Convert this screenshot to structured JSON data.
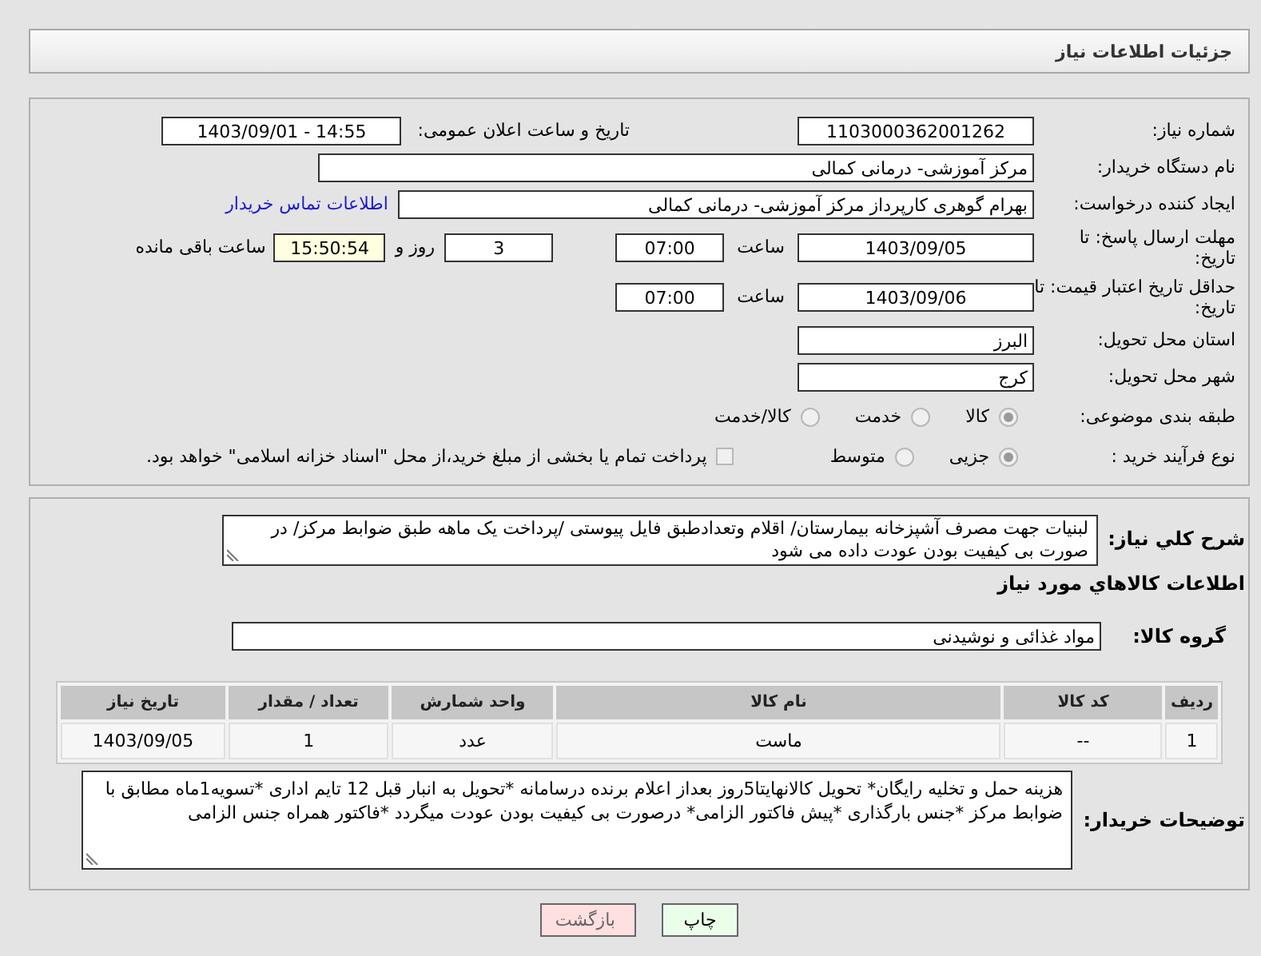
{
  "page_title": "جزئیات اطلاعات نیاز",
  "details": {
    "need_number": {
      "label": "شماره نیاز:",
      "value": "1103000362001262"
    },
    "announce_datetime": {
      "label": "تاریخ و ساعت اعلان عمومی:",
      "value": "1403/09/01 - 14:55"
    },
    "buyer_org": {
      "label": "نام دستگاه خریدار:",
      "value": "مرکز آموزشی- درمانی کمالی"
    },
    "requester": {
      "label": "ایجاد کننده درخواست:",
      "value": "بهرام گوهری کارپرداز مرکز آموزشی- درمانی کمالی",
      "link": "اطلاعات تماس خریدار"
    },
    "reply_deadline": {
      "label": "مهلت ارسال پاسخ: تا تاریخ:",
      "date": "1403/09/05",
      "time_label": "ساعت",
      "time": "07:00",
      "days": "3",
      "days_label": "روز و",
      "remaining": "15:50:54",
      "remaining_label": "ساعت باقی مانده"
    },
    "price_validity": {
      "label": "حداقل تاریخ اعتبار قیمت: تا تاریخ:",
      "date": "1403/09/06",
      "time_label": "ساعت",
      "time": "07:00"
    },
    "province": {
      "label": "استان محل تحویل:",
      "value": "البرز"
    },
    "city": {
      "label": "شهر محل تحویل:",
      "value": "کرج"
    },
    "category": {
      "label": "طبقه بندی موضوعی:",
      "options": [
        {
          "label": "کالا",
          "selected": true
        },
        {
          "label": "خدمت",
          "selected": false
        },
        {
          "label": "کالا/خدمت",
          "selected": false
        }
      ]
    },
    "process": {
      "label": "نوع فرآیند خرید :",
      "options": [
        {
          "label": "جزیی",
          "selected": true
        },
        {
          "label": "متوسط",
          "selected": false
        }
      ],
      "treasury": {
        "label": "پرداخت تمام یا بخشی از مبلغ خرید،از محل \"اسناد خزانه اسلامی\" خواهد بود.",
        "checked": false
      }
    }
  },
  "items": {
    "description": {
      "label": "شرح کلي نياز:",
      "value": "لبنیات جهت مصرف آشپزخانه بیمارستان/ اقلام وتعدادطبق فایل پیوستی /پرداخت یک ماهه طبق ضوابط مرکز/ در صورت بی کیفیت بودن عودت داده می شود"
    },
    "heading": "اطلاعات کالاهاي مورد نياز",
    "group": {
      "label": "گروه کالا:",
      "value": "مواد غذائی و نوشیدنی"
    },
    "table": {
      "columns": [
        "ردیف",
        "کد کالا",
        "نام کالا",
        "واحد شمارش",
        "تعداد / مقدار",
        "تاریخ نیاز"
      ],
      "rows": [
        [
          "1",
          "--",
          "ماست",
          "عدد",
          "1",
          "1403/09/05"
        ]
      ]
    },
    "buyer_notes": {
      "label": "توضیحات خریدار:",
      "value": "هزینه حمل و تخلیه رایگان* تحویل کالانهایتا5روز بعداز اعلام برنده درسامانه *تحویل به انبار قبل 12 تایم اداری *تسویه1ماه مطابق با ضوابط مرکز *جنس بارگذاری *پیش فاکتور الزامی* درصورت بی کیفیت بودن عودت میگردد *فاکتور همراه جنس الزامی"
    }
  },
  "buttons": [
    {
      "label": "چاپ",
      "kind": "print"
    },
    {
      "label": "بازگشت",
      "kind": "back"
    }
  ]
}
